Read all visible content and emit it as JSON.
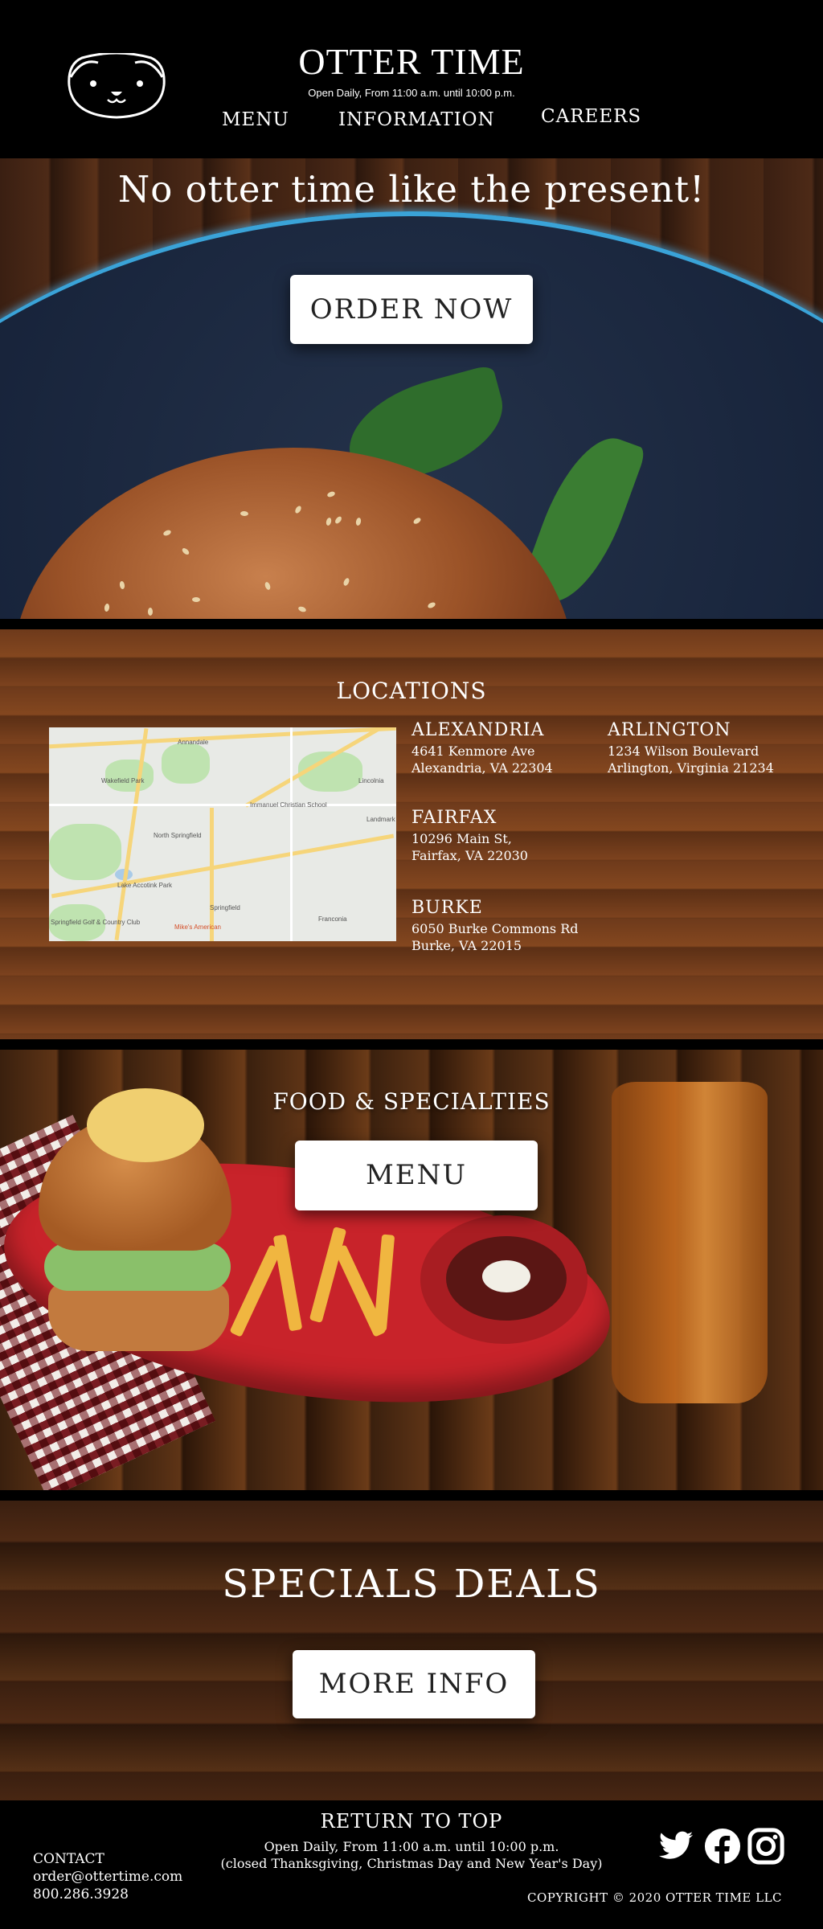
{
  "header": {
    "title": "OTTER TIME",
    "hours": "Open Daily, From 11:00 a.m. until 10:00 p.m.",
    "nav": [
      {
        "label": "MENU"
      },
      {
        "label": "INFORMATION"
      },
      {
        "label": "CAREERS"
      }
    ]
  },
  "hero": {
    "tagline": "No otter time like the present!",
    "order_button": "ORDER NOW"
  },
  "locations": {
    "title": "LOCATIONS",
    "map_labels": [
      "Annandale",
      "Wakefield Park",
      "Immanuel Christian School",
      "North Springfield",
      "Lake Accotink Park",
      "Springfield",
      "Springfield Golf & Country Club",
      "Mike's American",
      "Lincolnia",
      "Landmark",
      "Franconia"
    ],
    "items": [
      {
        "name": "ALEXANDRIA",
        "line1": "4641 Kenmore Ave",
        "line2": "Alexandria, VA 22304"
      },
      {
        "name": "ARLINGTON",
        "line1": "1234 Wilson Boulevard",
        "line2": "Arlington, Virginia 21234"
      },
      {
        "name": "FAIRFAX",
        "line1": "10296 Main St,",
        "line2": "Fairfax, VA 22030"
      },
      {
        "name": "BURKE",
        "line1": "6050 Burke Commons Rd",
        "line2": "Burke, VA 22015"
      }
    ]
  },
  "food": {
    "title": "FOOD & SPECIALTIES",
    "menu_button": "MENU"
  },
  "specials": {
    "title": "SPECIALS DEALS",
    "more_button": "MORE INFO"
  },
  "footer": {
    "return_top": "RETURN TO TOP",
    "hours_line1": "Open Daily, From 11:00 a.m. until 10:00 p.m.",
    "hours_line2": "(closed Thanksgiving, Christmas Day and New Year's Day)",
    "contact_label": "CONTACT",
    "email": "order@ottertime.com",
    "phone": "800.286.3928",
    "copyright": "COPYRIGHT © 2020 OTTER TIME LLC",
    "social_icons": [
      "twitter-icon",
      "facebook-icon",
      "instagram-icon"
    ]
  },
  "colors": {
    "header_bg": "#000000",
    "button_bg": "#ffffff",
    "plate_rim": "#3aa3d8",
    "food_plate": "#c8232a"
  }
}
